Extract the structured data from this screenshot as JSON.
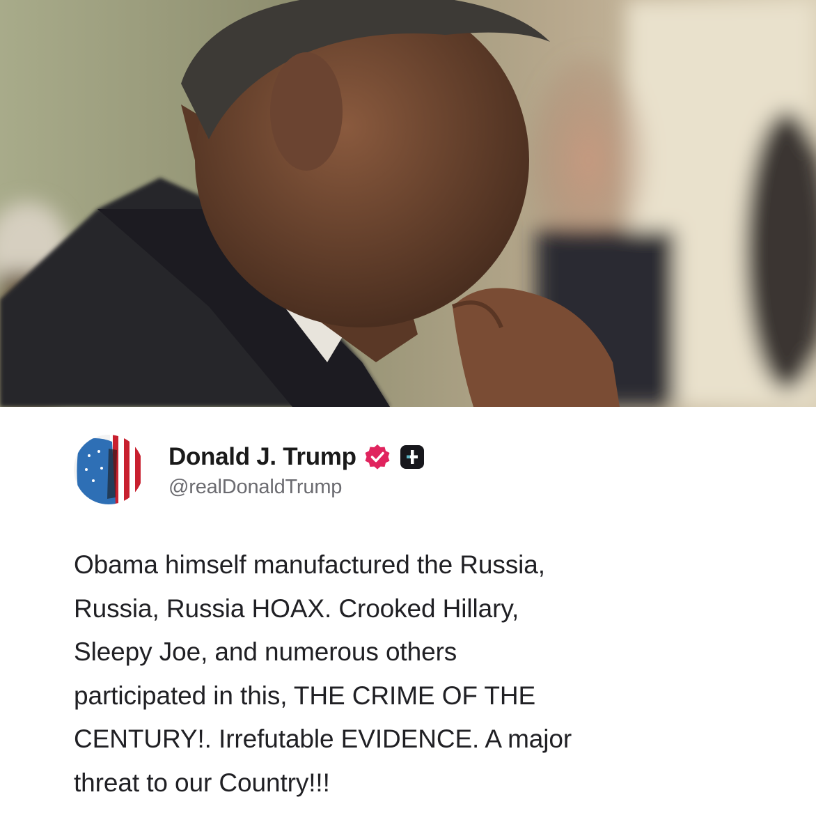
{
  "post": {
    "author_name": "Donald J. Trump",
    "author_handle": "@realDonaldTrump",
    "verified_icon": "verified-badge-icon",
    "verified_color": "#e0245e",
    "platform_icon": "truth-social-plus-icon",
    "text": "Obama himself manufactured the Russia,\nRussia, Russia HOAX. Crooked Hillary,\nSleepy Joe, and numerous others\nparticipated in this, THE CRIME OF THE\nCENTURY!. Irrefutable EVIDENCE. A major\nthreat to our Country!!!"
  },
  "media": {
    "photo_icon": "photo-of-man-in-suit"
  }
}
